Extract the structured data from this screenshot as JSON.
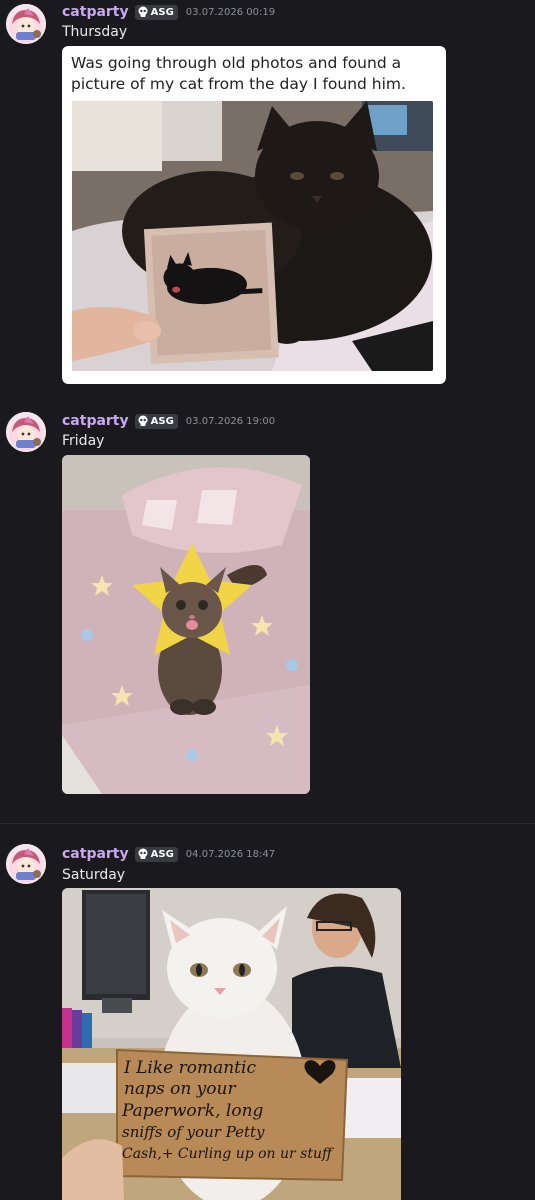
{
  "messages": [
    {
      "username": "catparty",
      "tag": "ASG",
      "timestamp": "03.07.2026 00:19",
      "text": "Thursday",
      "attachment": {
        "type": "meme-image",
        "caption": "Was going through old photos and found a picture of my cat from the day I found him."
      }
    },
    {
      "username": "catparty",
      "tag": "ASG",
      "timestamp": "03.07.2026 19:00",
      "text": "Friday",
      "attachment": {
        "type": "photo"
      }
    },
    {
      "username": "catparty",
      "tag": "ASG",
      "timestamp": "04.07.2026 18:47",
      "text": "Saturday",
      "attachment": {
        "type": "photo",
        "sign_lines": [
          "I Like romantic",
          "naps on your",
          "Paperwork, long",
          "sniffs of your Petty",
          "Cash,+ Curling up on ur stuff"
        ]
      }
    }
  ],
  "colors": {
    "background": "#1a1a1e",
    "username": "#c9a8f0",
    "tag_bg": "#3a3b41",
    "timestamp": "#8d9096",
    "text": "#e8e9eb"
  },
  "icons": {
    "tag_icon": "skull-icon",
    "avatar": "avatar-anime-girl-cat"
  }
}
